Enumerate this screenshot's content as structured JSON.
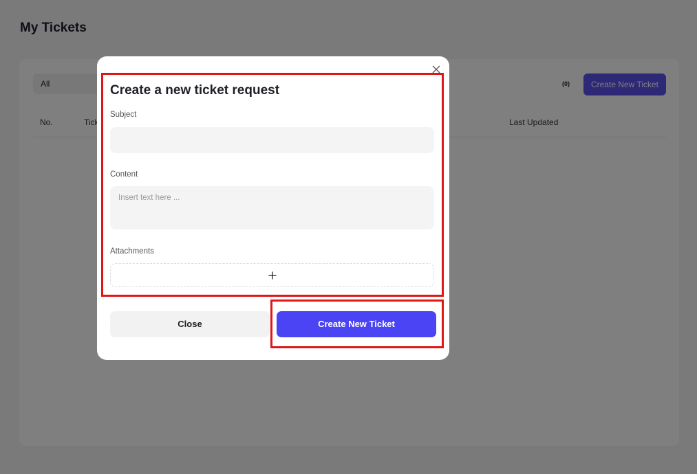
{
  "page": {
    "title": "My Tickets",
    "filter_value": "All",
    "ticket_count": "(0)",
    "create_button_label": "Create New Ticket",
    "columns": {
      "no": "No.",
      "ticket": "Tick",
      "last_updated": "Last Updated"
    }
  },
  "modal": {
    "title": "Create a new ticket request",
    "subject_label": "Subject",
    "subject_value": "",
    "content_label": "Content",
    "content_placeholder": "Insert text here ...",
    "attachments_label": "Attachments",
    "close_label": "Close",
    "create_label": "Create New Ticket"
  },
  "icons": {
    "close": "close-icon",
    "add_attachment": "plus-icon"
  },
  "colors": {
    "accent": "#4b44f5",
    "highlight": "#e01515",
    "overlay": "rgba(0,0,0,0.5)"
  }
}
